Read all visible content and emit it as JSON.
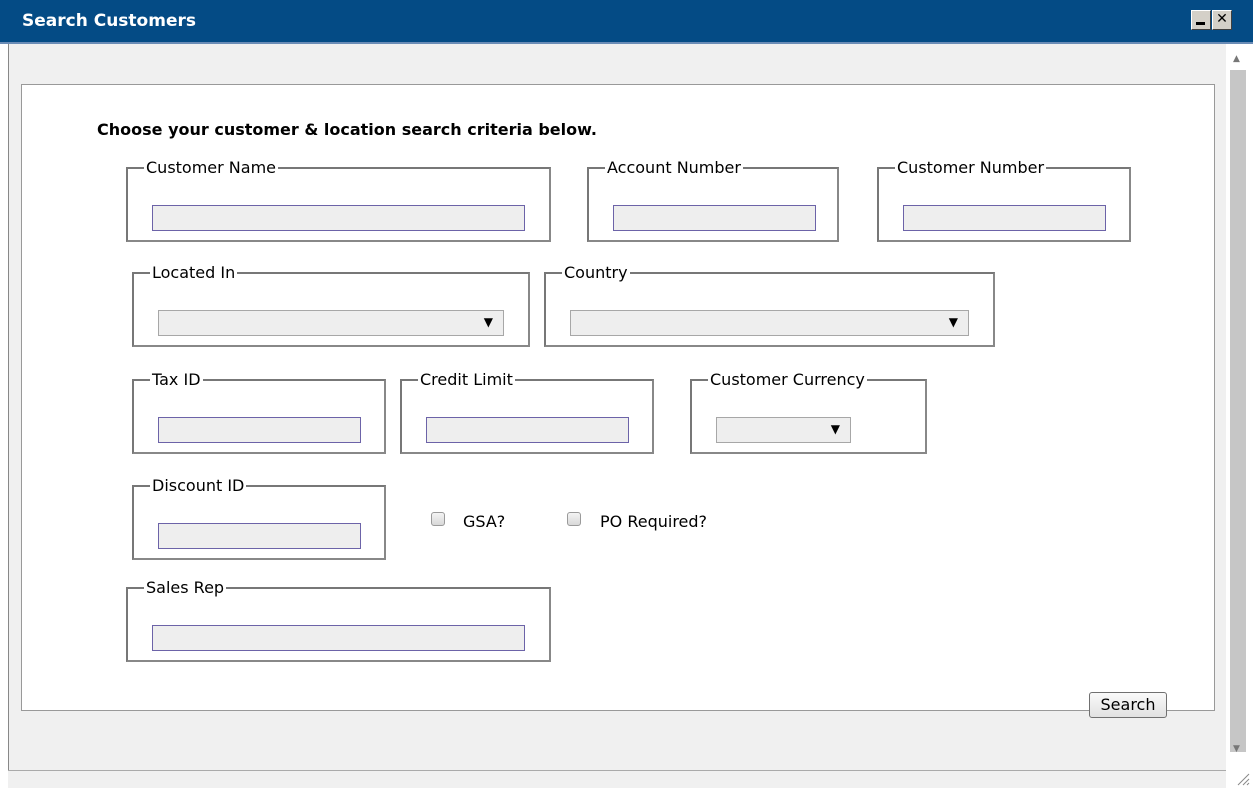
{
  "window": {
    "title": "Search Customers",
    "minimize_glyph": "_",
    "close_glyph": "✕"
  },
  "form": {
    "instructions": "Choose your customer & location search criteria below.",
    "fields": {
      "customer_name": {
        "label": "Customer Name",
        "value": ""
      },
      "account_number": {
        "label": "Account Number",
        "value": ""
      },
      "customer_number": {
        "label": "Customer Number",
        "value": ""
      },
      "located_in": {
        "label": "Located In",
        "selected": ""
      },
      "country": {
        "label": "Country",
        "selected": ""
      },
      "tax_id": {
        "label": "Tax ID",
        "value": ""
      },
      "credit_limit": {
        "label": "Credit Limit",
        "value": ""
      },
      "customer_currency": {
        "label": "Customer Currency",
        "selected": ""
      },
      "discount_id": {
        "label": "Discount ID",
        "value": ""
      },
      "sales_rep": {
        "label": "Sales Rep",
        "value": ""
      }
    },
    "checkboxes": {
      "gsa": {
        "label": "GSA?",
        "checked": false
      },
      "po_required": {
        "label": "PO Required?",
        "checked": false
      }
    },
    "dropdown_arrow": "▼"
  },
  "footer": {
    "search_label": "Search"
  },
  "scrollbar": {
    "up_glyph": "▲",
    "down_glyph": "▼"
  },
  "colors": {
    "titlebar": "#044b85",
    "input_border": "#6c63a8",
    "input_fill": "#eeeeee"
  }
}
